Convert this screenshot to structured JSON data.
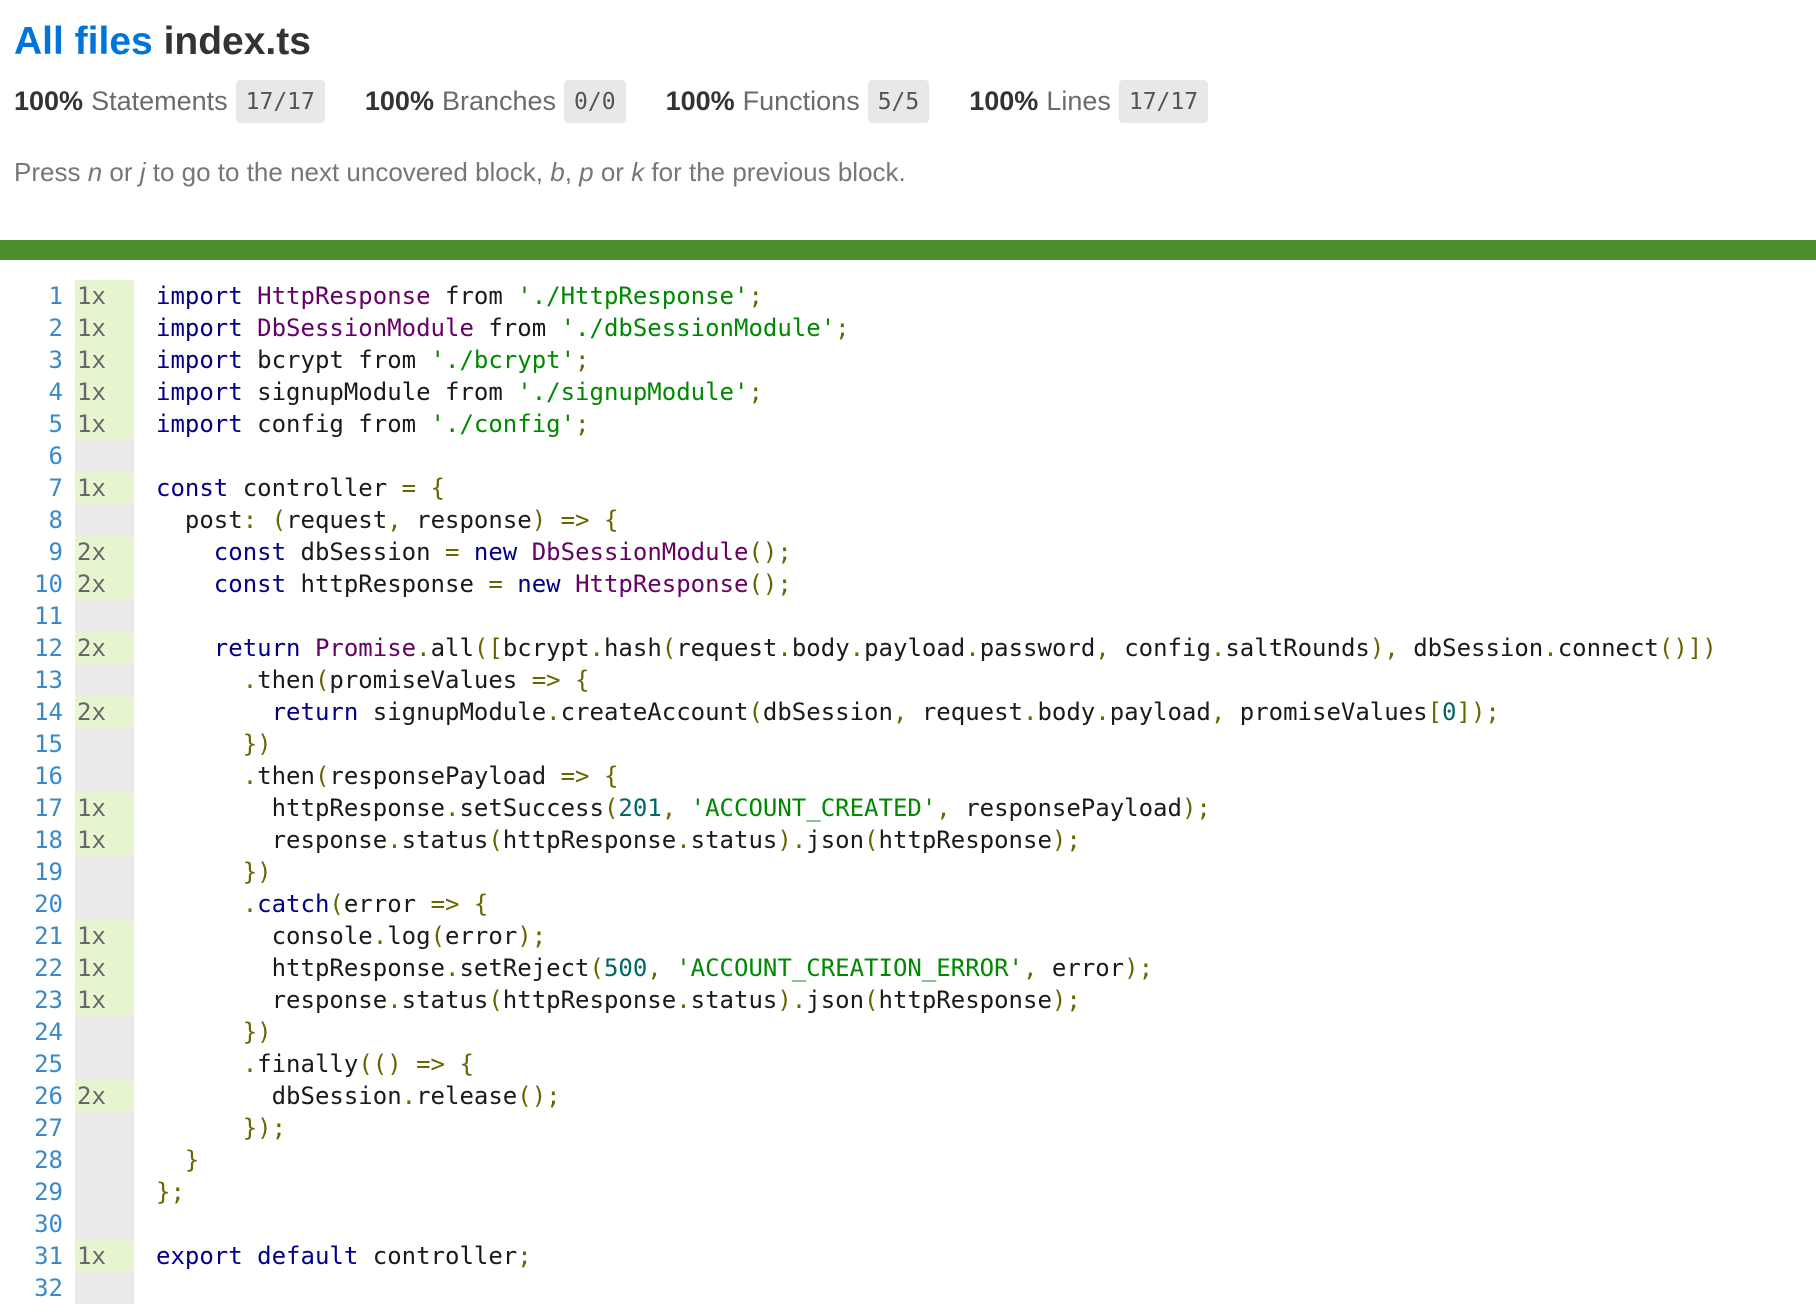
{
  "breadcrumb": {
    "all_files": "All files",
    "file": "index.ts"
  },
  "summary": [
    {
      "pct": "100%",
      "name": "Statements",
      "fraction": "17/17"
    },
    {
      "pct": "100%",
      "name": "Branches",
      "fraction": "0/0"
    },
    {
      "pct": "100%",
      "name": "Functions",
      "fraction": "5/5"
    },
    {
      "pct": "100%",
      "name": "Lines",
      "fraction": "17/17"
    }
  ],
  "hint": {
    "p1": "Press ",
    "n": "n",
    "p2": " or ",
    "j": "j",
    "p3": " to go to the next uncovered block, ",
    "b": "b",
    "p4": ", ",
    "p": "p",
    "p5": " or ",
    "k": "k",
    "p6": " for the previous block."
  },
  "colors": {
    "status_bar": "#4d8c2a",
    "link": "#0074d9",
    "covered": "#e6f5d0",
    "neutral": "#eaeaea"
  },
  "code": [
    {
      "n": "1",
      "c": "1x",
      "t": [
        [
          "kw",
          "import"
        ],
        [
          "pln",
          " "
        ],
        [
          "typ",
          "HttpResponse"
        ],
        [
          "pln",
          " from "
        ],
        [
          "str",
          "'./HttpResponse'"
        ],
        [
          "pun",
          ";"
        ]
      ]
    },
    {
      "n": "2",
      "c": "1x",
      "t": [
        [
          "kw",
          "import"
        ],
        [
          "pln",
          " "
        ],
        [
          "typ",
          "DbSessionModule"
        ],
        [
          "pln",
          " from "
        ],
        [
          "str",
          "'./dbSessionModule'"
        ],
        [
          "pun",
          ";"
        ]
      ]
    },
    {
      "n": "3",
      "c": "1x",
      "t": [
        [
          "kw",
          "import"
        ],
        [
          "pln",
          " bcrypt from "
        ],
        [
          "str",
          "'./bcrypt'"
        ],
        [
          "pun",
          ";"
        ]
      ]
    },
    {
      "n": "4",
      "c": "1x",
      "t": [
        [
          "kw",
          "import"
        ],
        [
          "pln",
          " signupModule from "
        ],
        [
          "str",
          "'./signupModule'"
        ],
        [
          "pun",
          ";"
        ]
      ]
    },
    {
      "n": "5",
      "c": "1x",
      "t": [
        [
          "kw",
          "import"
        ],
        [
          "pln",
          " config from "
        ],
        [
          "str",
          "'./config'"
        ],
        [
          "pun",
          ";"
        ]
      ]
    },
    {
      "n": "6",
      "c": "",
      "t": []
    },
    {
      "n": "7",
      "c": "1x",
      "t": [
        [
          "kw",
          "const"
        ],
        [
          "pln",
          " controller "
        ],
        [
          "pun",
          "= {"
        ]
      ]
    },
    {
      "n": "8",
      "c": "",
      "t": [
        [
          "pln",
          "  post"
        ],
        [
          "pun",
          ": ("
        ],
        [
          "pln",
          "request"
        ],
        [
          "pun",
          ","
        ],
        [
          "pln",
          " response"
        ],
        [
          "pun",
          ") => {"
        ]
      ]
    },
    {
      "n": "9",
      "c": "2x",
      "t": [
        [
          "pln",
          "    "
        ],
        [
          "kw",
          "const"
        ],
        [
          "pln",
          " dbSession "
        ],
        [
          "pun",
          "="
        ],
        [
          "pln",
          " "
        ],
        [
          "kw",
          "new"
        ],
        [
          "pln",
          " "
        ],
        [
          "typ",
          "DbSessionModule"
        ],
        [
          "pun",
          "();"
        ]
      ]
    },
    {
      "n": "10",
      "c": "2x",
      "t": [
        [
          "pln",
          "    "
        ],
        [
          "kw",
          "const"
        ],
        [
          "pln",
          " httpResponse "
        ],
        [
          "pun",
          "="
        ],
        [
          "pln",
          " "
        ],
        [
          "kw",
          "new"
        ],
        [
          "pln",
          " "
        ],
        [
          "typ",
          "HttpResponse"
        ],
        [
          "pun",
          "();"
        ]
      ]
    },
    {
      "n": "11",
      "c": "",
      "t": []
    },
    {
      "n": "12",
      "c": "2x",
      "t": [
        [
          "pln",
          "    "
        ],
        [
          "kw",
          "return"
        ],
        [
          "pln",
          " "
        ],
        [
          "typ",
          "Promise"
        ],
        [
          "pun",
          "."
        ],
        [
          "pln",
          "all"
        ],
        [
          "pun",
          "(["
        ],
        [
          "pln",
          "bcrypt"
        ],
        [
          "pun",
          "."
        ],
        [
          "pln",
          "hash"
        ],
        [
          "pun",
          "("
        ],
        [
          "pln",
          "request"
        ],
        [
          "pun",
          "."
        ],
        [
          "pln",
          "body"
        ],
        [
          "pun",
          "."
        ],
        [
          "pln",
          "payload"
        ],
        [
          "pun",
          "."
        ],
        [
          "pln",
          "password"
        ],
        [
          "pun",
          ","
        ],
        [
          "pln",
          " config"
        ],
        [
          "pun",
          "."
        ],
        [
          "pln",
          "saltRounds"
        ],
        [
          "pun",
          "),"
        ],
        [
          "pln",
          " dbSession"
        ],
        [
          "pun",
          "."
        ],
        [
          "pln",
          "connect"
        ],
        [
          "pun",
          "()])"
        ]
      ]
    },
    {
      "n": "13",
      "c": "",
      "t": [
        [
          "pln",
          "      "
        ],
        [
          "pun",
          "."
        ],
        [
          "pln",
          "then"
        ],
        [
          "pun",
          "("
        ],
        [
          "pln",
          "promiseValues "
        ],
        [
          "pun",
          "=> {"
        ]
      ]
    },
    {
      "n": "14",
      "c": "2x",
      "t": [
        [
          "pln",
          "        "
        ],
        [
          "kw",
          "return"
        ],
        [
          "pln",
          " signupModule"
        ],
        [
          "pun",
          "."
        ],
        [
          "pln",
          "createAccount"
        ],
        [
          "pun",
          "("
        ],
        [
          "pln",
          "dbSession"
        ],
        [
          "pun",
          ","
        ],
        [
          "pln",
          " request"
        ],
        [
          "pun",
          "."
        ],
        [
          "pln",
          "body"
        ],
        [
          "pun",
          "."
        ],
        [
          "pln",
          "payload"
        ],
        [
          "pun",
          ","
        ],
        [
          "pln",
          " promiseValues"
        ],
        [
          "pun",
          "["
        ],
        [
          "lit",
          "0"
        ],
        [
          "pun",
          "]);"
        ]
      ]
    },
    {
      "n": "15",
      "c": "",
      "t": [
        [
          "pln",
          "      "
        ],
        [
          "pun",
          "})"
        ]
      ]
    },
    {
      "n": "16",
      "c": "",
      "t": [
        [
          "pln",
          "      "
        ],
        [
          "pun",
          "."
        ],
        [
          "pln",
          "then"
        ],
        [
          "pun",
          "("
        ],
        [
          "pln",
          "responsePayload "
        ],
        [
          "pun",
          "=> {"
        ]
      ]
    },
    {
      "n": "17",
      "c": "1x",
      "t": [
        [
          "pln",
          "        httpResponse"
        ],
        [
          "pun",
          "."
        ],
        [
          "pln",
          "setSuccess"
        ],
        [
          "pun",
          "("
        ],
        [
          "lit",
          "201"
        ],
        [
          "pun",
          ","
        ],
        [
          "pln",
          " "
        ],
        [
          "str",
          "'ACCOUNT_CREATED'"
        ],
        [
          "pun",
          ","
        ],
        [
          "pln",
          " responsePayload"
        ],
        [
          "pun",
          ");"
        ]
      ]
    },
    {
      "n": "18",
      "c": "1x",
      "t": [
        [
          "pln",
          "        response"
        ],
        [
          "pun",
          "."
        ],
        [
          "pln",
          "status"
        ],
        [
          "pun",
          "("
        ],
        [
          "pln",
          "httpResponse"
        ],
        [
          "pun",
          "."
        ],
        [
          "pln",
          "status"
        ],
        [
          "pun",
          ")."
        ],
        [
          "pln",
          "json"
        ],
        [
          "pun",
          "("
        ],
        [
          "pln",
          "httpResponse"
        ],
        [
          "pun",
          ");"
        ]
      ]
    },
    {
      "n": "19",
      "c": "",
      "t": [
        [
          "pln",
          "      "
        ],
        [
          "pun",
          "})"
        ]
      ]
    },
    {
      "n": "20",
      "c": "",
      "t": [
        [
          "pln",
          "      "
        ],
        [
          "pun",
          "."
        ],
        [
          "kw",
          "catch"
        ],
        [
          "pun",
          "("
        ],
        [
          "pln",
          "error "
        ],
        [
          "pun",
          "=> {"
        ]
      ]
    },
    {
      "n": "21",
      "c": "1x",
      "t": [
        [
          "pln",
          "        console"
        ],
        [
          "pun",
          "."
        ],
        [
          "pln",
          "log"
        ],
        [
          "pun",
          "("
        ],
        [
          "pln",
          "error"
        ],
        [
          "pun",
          ");"
        ]
      ]
    },
    {
      "n": "22",
      "c": "1x",
      "t": [
        [
          "pln",
          "        httpResponse"
        ],
        [
          "pun",
          "."
        ],
        [
          "pln",
          "setReject"
        ],
        [
          "pun",
          "("
        ],
        [
          "lit",
          "500"
        ],
        [
          "pun",
          ","
        ],
        [
          "pln",
          " "
        ],
        [
          "str",
          "'ACCOUNT_CREATION_ERROR'"
        ],
        [
          "pun",
          ","
        ],
        [
          "pln",
          " error"
        ],
        [
          "pun",
          ");"
        ]
      ]
    },
    {
      "n": "23",
      "c": "1x",
      "t": [
        [
          "pln",
          "        response"
        ],
        [
          "pun",
          "."
        ],
        [
          "pln",
          "status"
        ],
        [
          "pun",
          "("
        ],
        [
          "pln",
          "httpResponse"
        ],
        [
          "pun",
          "."
        ],
        [
          "pln",
          "status"
        ],
        [
          "pun",
          ")."
        ],
        [
          "pln",
          "json"
        ],
        [
          "pun",
          "("
        ],
        [
          "pln",
          "httpResponse"
        ],
        [
          "pun",
          ");"
        ]
      ]
    },
    {
      "n": "24",
      "c": "",
      "t": [
        [
          "pln",
          "      "
        ],
        [
          "pun",
          "})"
        ]
      ]
    },
    {
      "n": "25",
      "c": "",
      "t": [
        [
          "pln",
          "      "
        ],
        [
          "pun",
          "."
        ],
        [
          "pln",
          "finally"
        ],
        [
          "pun",
          "(() => {"
        ]
      ]
    },
    {
      "n": "26",
      "c": "2x",
      "t": [
        [
          "pln",
          "        dbSession"
        ],
        [
          "pun",
          "."
        ],
        [
          "pln",
          "release"
        ],
        [
          "pun",
          "();"
        ]
      ]
    },
    {
      "n": "27",
      "c": "",
      "t": [
        [
          "pln",
          "      "
        ],
        [
          "pun",
          "});"
        ]
      ]
    },
    {
      "n": "28",
      "c": "",
      "t": [
        [
          "pln",
          "  "
        ],
        [
          "pun",
          "}"
        ]
      ]
    },
    {
      "n": "29",
      "c": "",
      "t": [
        [
          "pun",
          "};"
        ]
      ]
    },
    {
      "n": "30",
      "c": "",
      "t": []
    },
    {
      "n": "31",
      "c": "1x",
      "t": [
        [
          "kw",
          "export"
        ],
        [
          "pln",
          " "
        ],
        [
          "kw",
          "default"
        ],
        [
          "pln",
          " controller"
        ],
        [
          "pun",
          ";"
        ]
      ]
    },
    {
      "n": "32",
      "c": "",
      "t": []
    }
  ]
}
